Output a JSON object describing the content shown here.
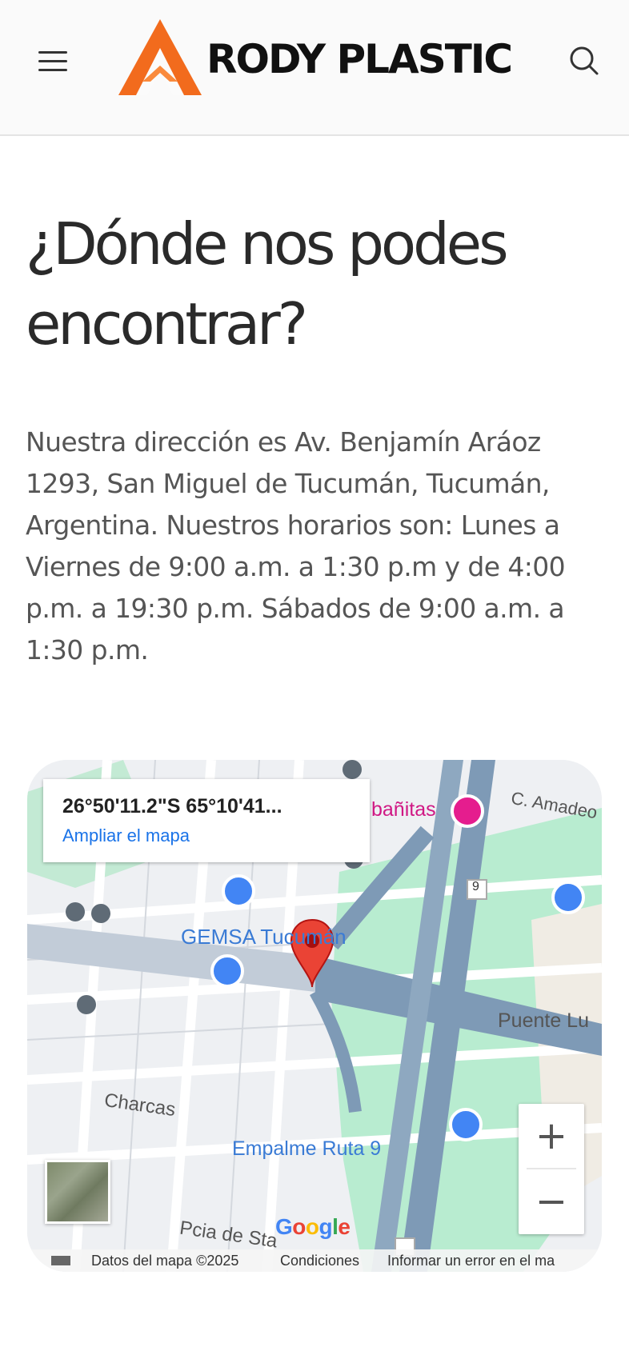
{
  "header": {
    "brand": "RODY PLASTIC",
    "brand_color": "#f26b1d"
  },
  "title": "¿Dónde nos podes encontrar?",
  "description": "Nuestra dirección es Av. Benjamín Aráoz 1293, San Miguel de Tucumán, Tucumán, Argentina. Nuestros horarios son: Lunes a Viernes de 9:00 a.m. a 1:30 p.m y de 4:00 p.m. a 19:30 p.m. Sábados de 9:00 a.m. a 1:30 p.m.",
  "map": {
    "coordinates": "26°50'11.2\"S 65°10'41...",
    "enlarge_link": "Ampliar el mapa",
    "labels": {
      "cabanitas": "bañitas",
      "amadeo": "C. Amadeo",
      "gemsa": "GEMSA Tucumán",
      "puente": "Puente Lu",
      "charcas": "Charcas",
      "empalme": "Empalme Ruta 9",
      "pcia": "Pcia de Sta",
      "route": "9"
    },
    "zoom_in": "+",
    "zoom_out": "−",
    "google_logo": [
      "G",
      "o",
      "o",
      "g",
      "l",
      "e"
    ],
    "google_colors": [
      "#4285f4",
      "#ea4335",
      "#fbbc05",
      "#4285f4",
      "#34a853",
      "#ea4335"
    ],
    "attribution": {
      "data": "Datos del mapa ©2025",
      "terms": "Condiciones",
      "report": "Informar un error en el ma"
    }
  }
}
